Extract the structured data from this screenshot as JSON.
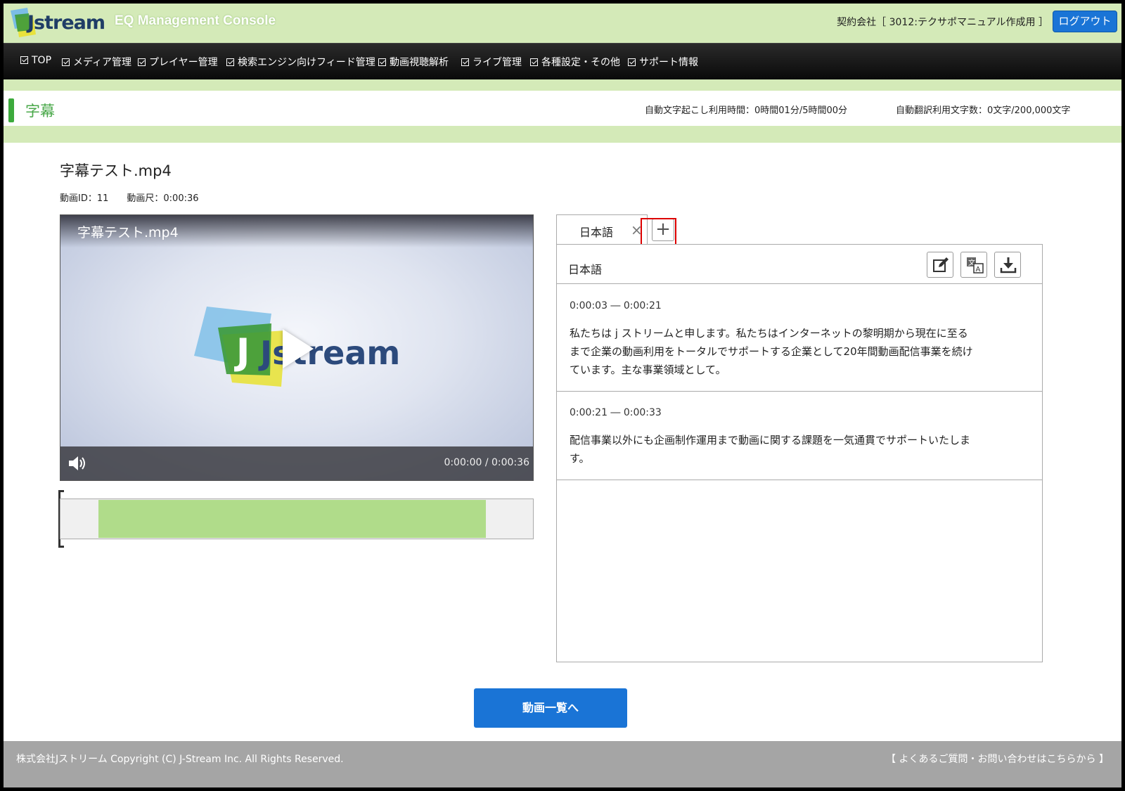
{
  "header": {
    "logo_text": "Jstream",
    "console_title": "EQ Management Console",
    "contract": "契約会社［ 3012:テクサポマニュアル作成用 ］",
    "logout_label": "ログアウト"
  },
  "nav": {
    "items": [
      {
        "label": "TOP"
      },
      {
        "label": "メディア管理"
      },
      {
        "label": "プレイヤー管理"
      },
      {
        "label": "検索エンジン向けフィード管理"
      },
      {
        "label": "動画視聴解析"
      },
      {
        "label": "ライブ管理"
      },
      {
        "label": "各種設定・その他"
      },
      {
        "label": "サポート情報"
      }
    ]
  },
  "page": {
    "title": "字幕",
    "usage_transcription": "自動文字起こし利用時間：0時間01分/5時間00分",
    "usage_translation": "自動翻訳利用文字数：0文字/200,000文字"
  },
  "video": {
    "file_title": "字幕テスト.mp4",
    "id_label": "動画ID：11",
    "duration_label": "動画尺：0:00:36",
    "player_title": "字幕テスト.mp4",
    "video_logo_text": "Jstream",
    "timecode": "0:00:00 / 0:00:36",
    "timeline_selection": {
      "start_fraction": 0.08,
      "end_fraction": 0.9
    }
  },
  "subtitles": {
    "tab_label": "日本語",
    "close_icon": "×",
    "add_icon": "+",
    "panel_language": "日本語",
    "tools": [
      "edit-icon",
      "translate-icon",
      "download-icon"
    ],
    "cues": [
      {
        "time": "0:00:03 ― 0:00:21",
        "text": "私たちは j ストリームと申します。私たちはインターネットの黎明期から現在に至るまで企業の動画利用をトータルでサポートする企業として20年間動画配信事業を続けています。主な事業領域として。"
      },
      {
        "time": "0:00:21 ― 0:00:33",
        "text": "配信事業以外にも企画制作運用まで動画に関する課題を一気通貫でサポートいたします。"
      }
    ]
  },
  "actions": {
    "video_list_label": "動画一覧へ"
  },
  "footer": {
    "copyright": "株式会社Jストリーム Copyright (C) J-Stream Inc. All Rights Reserved.",
    "help_link": "【 よくあるご質問・お問い合わせはこちらから 】"
  },
  "colors": {
    "header_green": "#d4eab8",
    "accent_green": "#3caa3c",
    "primary_blue": "#1a74d6",
    "highlight_red": "#dd0000"
  }
}
